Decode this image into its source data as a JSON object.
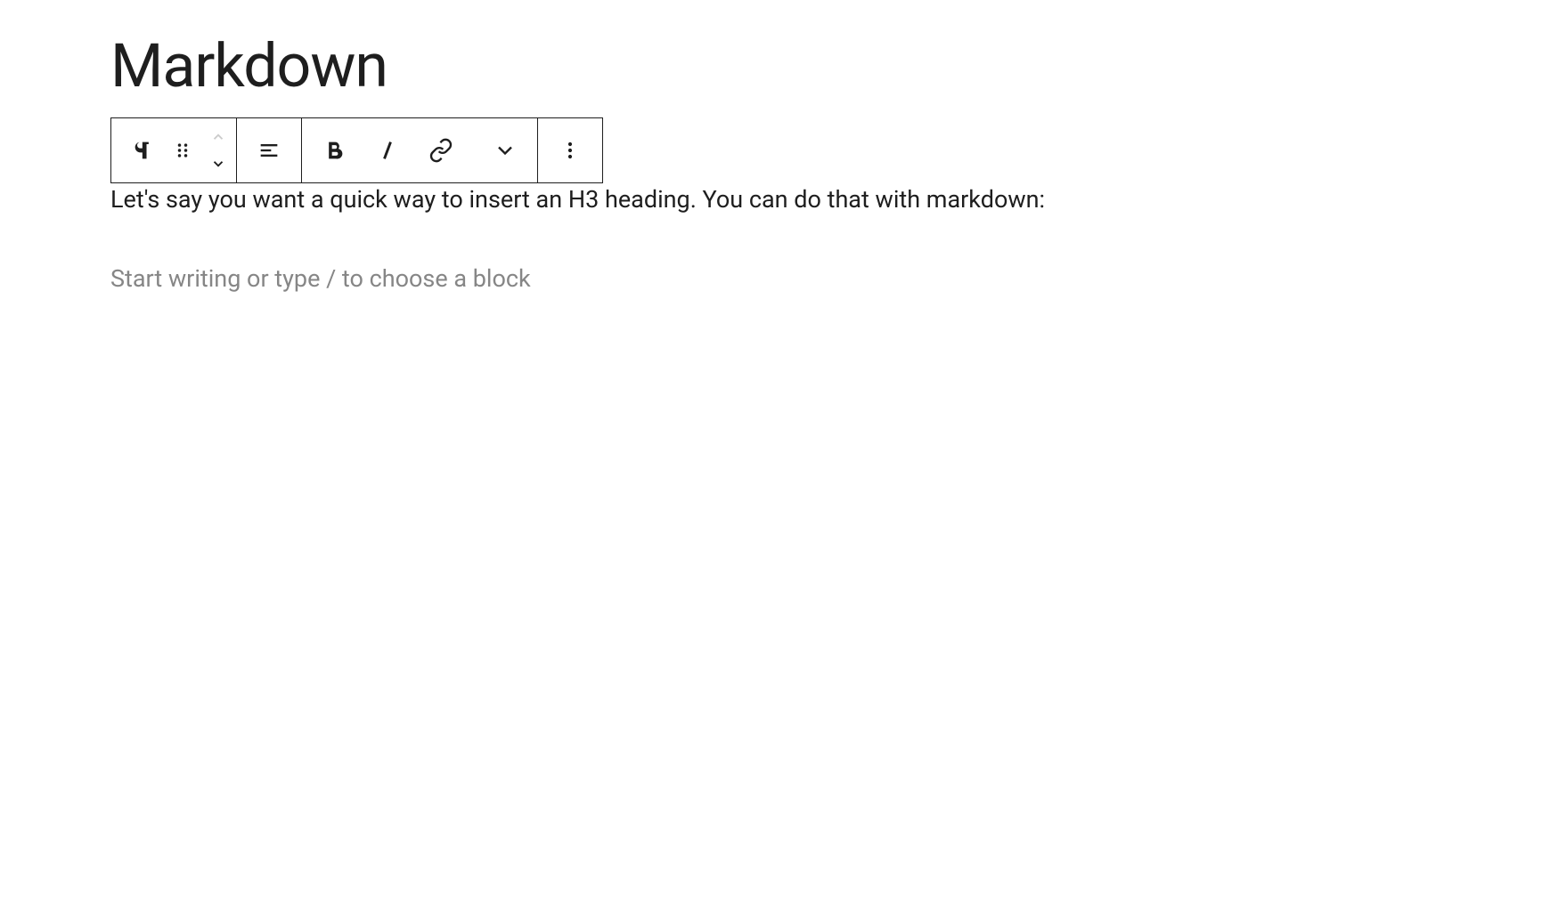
{
  "page": {
    "title": "Markdown"
  },
  "content": {
    "paragraph": "Let's say you want a quick way to insert an H3 heading. You can do that with markdown:",
    "placeholder": "Start writing or type / to choose a block"
  },
  "toolbar": {
    "block_type": "paragraph",
    "drag_handle": "drag",
    "move_up": "move-up",
    "move_down": "move-down",
    "align": "align-left",
    "bold": "B",
    "italic": "I",
    "link": "link",
    "more_formatting": "more-formatting",
    "options": "options"
  }
}
